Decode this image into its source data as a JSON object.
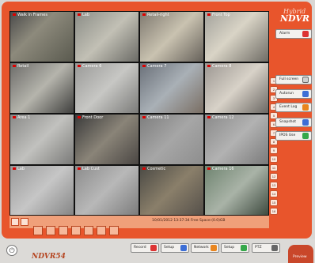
{
  "app": {
    "brand_top": "Hybrid",
    "brand_main": "NDVR",
    "footer_brand": "NDVR54"
  },
  "buttons": {
    "alarm": "Alarm",
    "fullscreen": "Full screen",
    "autorun": "Autorun",
    "eventlog": "Event Log",
    "snapshot": "Snapshot",
    "ipos": "IPOS Use"
  },
  "toolbar": {
    "record": "Record",
    "setup_a": "Setup",
    "network": "Network",
    "setup_b": "Setup",
    "ptz": "PTZ",
    "preview": "Preview"
  },
  "status": {
    "text": "10/01/2012 13:37:34   Free Space:(0.0)GB"
  },
  "cameras": [
    {
      "label": "Walk In Frames"
    },
    {
      "label": "Lab"
    },
    {
      "label": "Retail-right"
    },
    {
      "label": "Front Top"
    },
    {
      "label": "Retail"
    },
    {
      "label": "Camera 6"
    },
    {
      "label": "Camera 7"
    },
    {
      "label": "Camera 8"
    },
    {
      "label": "Area 1"
    },
    {
      "label": "Front Door"
    },
    {
      "label": "Camera 11"
    },
    {
      "label": "Camera 12"
    },
    {
      "label": "Lab"
    },
    {
      "label": "Lab Cust"
    },
    {
      "label": "Cosmetic"
    },
    {
      "label": "Camera 16"
    }
  ],
  "channels": [
    "1",
    "2",
    "3",
    "4",
    "5",
    "6",
    "7",
    "8",
    "9",
    "10",
    "11",
    "12",
    "13",
    "14",
    "15",
    "16"
  ],
  "colors": {
    "accent": "#e8552c",
    "frame": "#e8552c",
    "icon_blue": "#3d6ed6",
    "icon_orange": "#e9851e",
    "icon_green": "#35a84a"
  }
}
